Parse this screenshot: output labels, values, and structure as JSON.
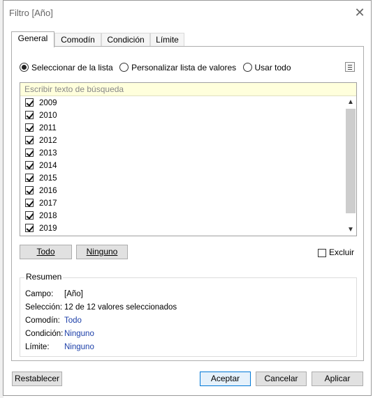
{
  "window": {
    "title": "Filtro [Año]",
    "close_glyph": "✕"
  },
  "tabs": [
    {
      "label": "General",
      "active": true
    },
    {
      "label": "Comodín",
      "active": false
    },
    {
      "label": "Condición",
      "active": false
    },
    {
      "label": "Límite",
      "active": false
    }
  ],
  "selection_mode": {
    "options": [
      {
        "label": "Seleccionar de la lista",
        "checked": true
      },
      {
        "label": "Personalizar lista de valores",
        "checked": false
      },
      {
        "label": "Usar todo",
        "checked": false
      }
    ]
  },
  "list": {
    "search_placeholder": "Escribir texto de búsqueda",
    "items": [
      {
        "label": "2009",
        "checked": true
      },
      {
        "label": "2010",
        "checked": true
      },
      {
        "label": "2011",
        "checked": true
      },
      {
        "label": "2012",
        "checked": true
      },
      {
        "label": "2013",
        "checked": true
      },
      {
        "label": "2014",
        "checked": true
      },
      {
        "label": "2015",
        "checked": true
      },
      {
        "label": "2016",
        "checked": true
      },
      {
        "label": "2017",
        "checked": true
      },
      {
        "label": "2018",
        "checked": true
      },
      {
        "label": "2019",
        "checked": true
      }
    ]
  },
  "list_buttons": {
    "all": "Todo",
    "none": "Ninguno"
  },
  "exclude": {
    "label": "Excluir",
    "checked": false
  },
  "summary": {
    "title": "Resumen",
    "rows": [
      {
        "key": "Campo:",
        "value": "[Año]"
      },
      {
        "key": "Selección:",
        "value": "12 de 12 valores seleccionados"
      },
      {
        "key": "Comodín:",
        "value": "Todo"
      },
      {
        "key": "Condición:",
        "value": "Ninguno"
      },
      {
        "key": "Límite:",
        "value": "Ninguno"
      }
    ]
  },
  "footer": {
    "reset": "Restablecer",
    "accept": "Aceptar",
    "cancel": "Cancelar",
    "apply": "Aplicar"
  },
  "colors": {
    "link": "#1b3ea8",
    "search_bg": "#ffffdc",
    "primary_border": "#0078d7"
  }
}
